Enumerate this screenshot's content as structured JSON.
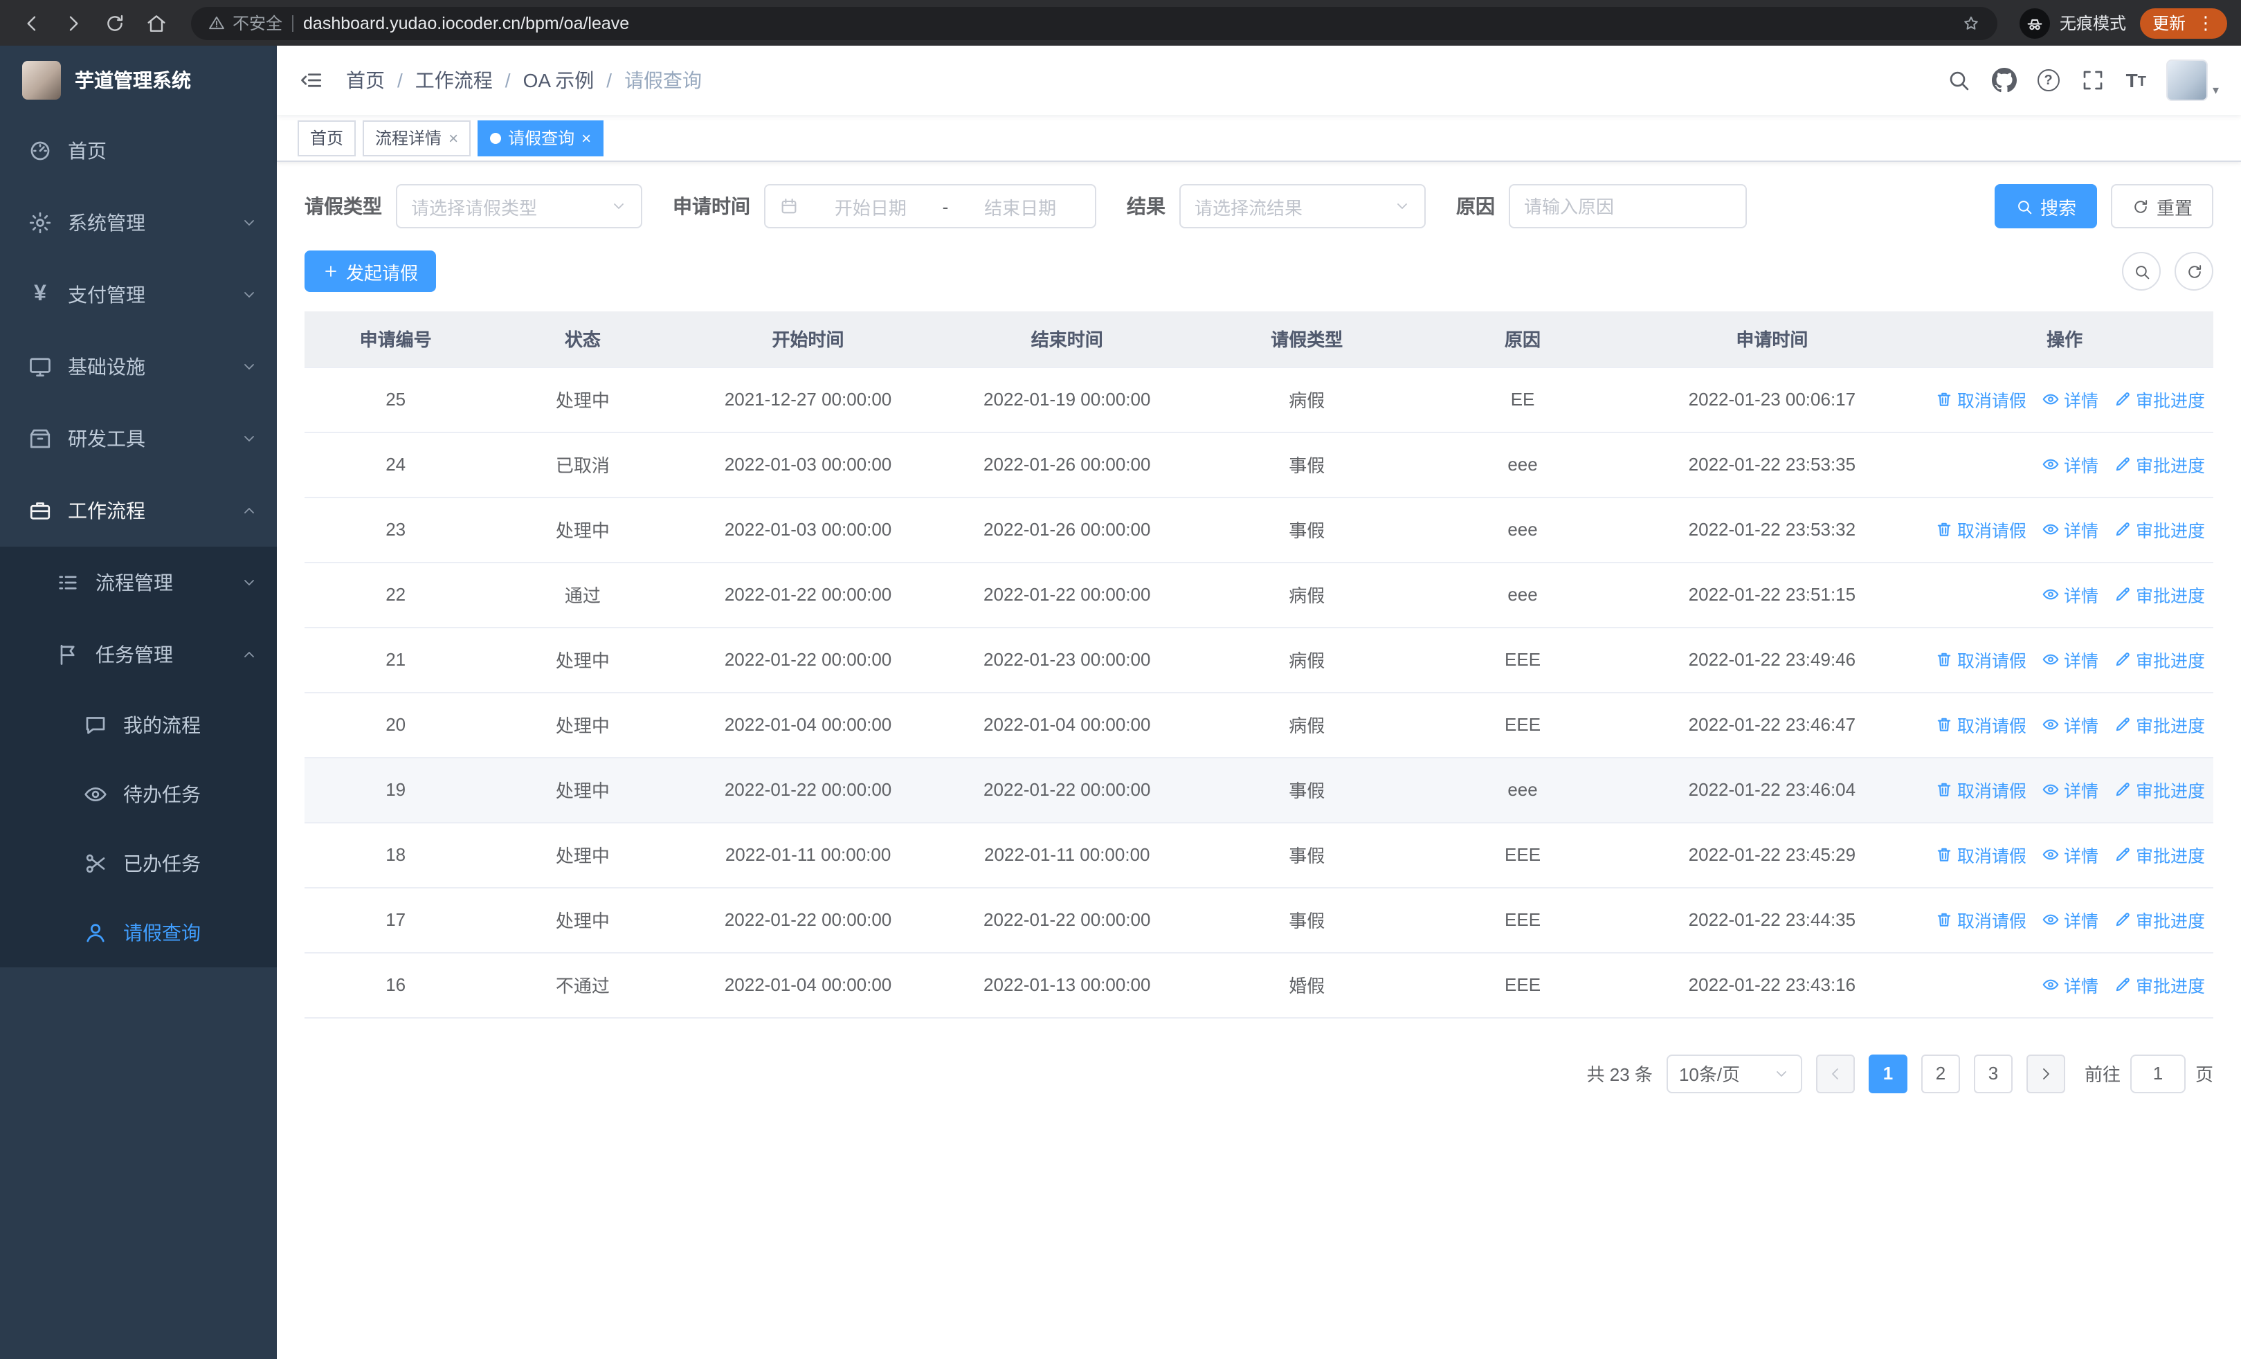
{
  "browser": {
    "security_label": "不安全",
    "url": "dashboard.yudao.iocoder.cn/bpm/oa/leave",
    "incognito_label": "无痕模式",
    "update_label": "更新"
  },
  "sidebar": {
    "logo_title": "芋道管理系统",
    "home": "首页",
    "system": "系统管理",
    "payment": "支付管理",
    "infra": "基础设施",
    "devtools": "研发工具",
    "workflow": "工作流程",
    "process_mgmt": "流程管理",
    "task_mgmt": "任务管理",
    "my_process": "我的流程",
    "todo_tasks": "待办任务",
    "done_tasks": "已办任务",
    "leave_query": "请假查询"
  },
  "header": {
    "breadcrumb": [
      "首页",
      "工作流程",
      "OA 示例",
      "请假查询"
    ]
  },
  "tabs": {
    "home": "首页",
    "process_detail": "流程详情",
    "leave_query": "请假查询"
  },
  "filters": {
    "leave_type_label": "请假类型",
    "leave_type_placeholder": "请选择请假类型",
    "apply_time_label": "申请时间",
    "start_date_placeholder": "开始日期",
    "range_separator": "-",
    "end_date_placeholder": "结束日期",
    "result_label": "结果",
    "result_placeholder": "请选择流结果",
    "reason_label": "原因",
    "reason_placeholder": "请输入原因",
    "search_button": "搜索",
    "reset_button": "重置"
  },
  "toolbar": {
    "create_button": "发起请假"
  },
  "table": {
    "columns": [
      "申请编号",
      "状态",
      "开始时间",
      "结束时间",
      "请假类型",
      "原因",
      "申请时间",
      "操作"
    ],
    "action_labels": {
      "cancel": "取消请假",
      "detail": "详情",
      "progress": "审批进度"
    },
    "rows": [
      {
        "id": "25",
        "status": "处理中",
        "start": "2021-12-27 00:00:00",
        "end": "2022-01-19 00:00:00",
        "type": "病假",
        "reason": "EE",
        "apply_time": "2022-01-23 00:06:17",
        "actions": [
          "cancel",
          "detail",
          "progress"
        ],
        "highlight": false
      },
      {
        "id": "24",
        "status": "已取消",
        "start": "2022-01-03 00:00:00",
        "end": "2022-01-26 00:00:00",
        "type": "事假",
        "reason": "eee",
        "apply_time": "2022-01-22 23:53:35",
        "actions": [
          "detail",
          "progress"
        ],
        "highlight": false
      },
      {
        "id": "23",
        "status": "处理中",
        "start": "2022-01-03 00:00:00",
        "end": "2022-01-26 00:00:00",
        "type": "事假",
        "reason": "eee",
        "apply_time": "2022-01-22 23:53:32",
        "actions": [
          "cancel",
          "detail",
          "progress"
        ],
        "highlight": false
      },
      {
        "id": "22",
        "status": "通过",
        "start": "2022-01-22 00:00:00",
        "end": "2022-01-22 00:00:00",
        "type": "病假",
        "reason": "eee",
        "apply_time": "2022-01-22 23:51:15",
        "actions": [
          "detail",
          "progress"
        ],
        "highlight": false
      },
      {
        "id": "21",
        "status": "处理中",
        "start": "2022-01-22 00:00:00",
        "end": "2022-01-23 00:00:00",
        "type": "病假",
        "reason": "EEE",
        "apply_time": "2022-01-22 23:49:46",
        "actions": [
          "cancel",
          "detail",
          "progress"
        ],
        "highlight": false
      },
      {
        "id": "20",
        "status": "处理中",
        "start": "2022-01-04 00:00:00",
        "end": "2022-01-04 00:00:00",
        "type": "病假",
        "reason": "EEE",
        "apply_time": "2022-01-22 23:46:47",
        "actions": [
          "cancel",
          "detail",
          "progress"
        ],
        "highlight": false
      },
      {
        "id": "19",
        "status": "处理中",
        "start": "2022-01-22 00:00:00",
        "end": "2022-01-22 00:00:00",
        "type": "事假",
        "reason": "eee",
        "apply_time": "2022-01-22 23:46:04",
        "actions": [
          "cancel",
          "detail",
          "progress"
        ],
        "highlight": true
      },
      {
        "id": "18",
        "status": "处理中",
        "start": "2022-01-11 00:00:00",
        "end": "2022-01-11 00:00:00",
        "type": "事假",
        "reason": "EEE",
        "apply_time": "2022-01-22 23:45:29",
        "actions": [
          "cancel",
          "detail",
          "progress"
        ],
        "highlight": false
      },
      {
        "id": "17",
        "status": "处理中",
        "start": "2022-01-22 00:00:00",
        "end": "2022-01-22 00:00:00",
        "type": "事假",
        "reason": "EEE",
        "apply_time": "2022-01-22 23:44:35",
        "actions": [
          "cancel",
          "detail",
          "progress"
        ],
        "highlight": false
      },
      {
        "id": "16",
        "status": "不通过",
        "start": "2022-01-04 00:00:00",
        "end": "2022-01-13 00:00:00",
        "type": "婚假",
        "reason": "EEE",
        "apply_time": "2022-01-22 23:43:16",
        "actions": [
          "detail",
          "progress"
        ],
        "highlight": false
      }
    ]
  },
  "pagination": {
    "total_label": "共 23 条",
    "page_size_label": "10条/页",
    "pages": [
      "1",
      "2",
      "3"
    ],
    "goto_prefix": "前往",
    "goto_value": "1",
    "goto_suffix": "页"
  }
}
